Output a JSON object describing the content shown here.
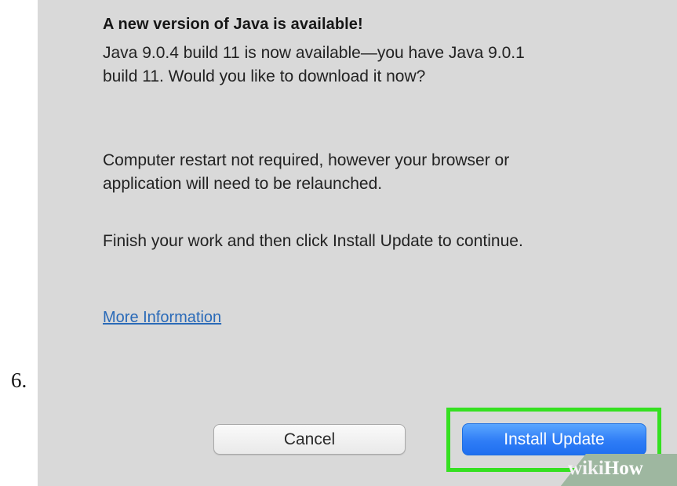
{
  "step": {
    "number": "6."
  },
  "dialog": {
    "title": "A new version of Java is available!",
    "paragraph_1_line_1": "Java 9.0.4 build 11 is now available—you have Java 9.0.1",
    "paragraph_1_line_2": "build 11. Would you like to download it now?",
    "paragraph_2_line_1": "Computer restart not required, however your browser or",
    "paragraph_2_line_2": "application will need to be relaunched.",
    "paragraph_3": "Finish your work and then click Install Update to continue.",
    "more_info_link": "More Information"
  },
  "buttons": {
    "cancel_label": "Cancel",
    "install_label": "Install Update"
  },
  "watermark": {
    "wiki": "wiki",
    "how": "How"
  },
  "colors": {
    "dialog_background": "#d9d9d9",
    "highlight_border": "#35e021",
    "primary_button": "#2f7df6",
    "link": "#2a6ab8"
  }
}
